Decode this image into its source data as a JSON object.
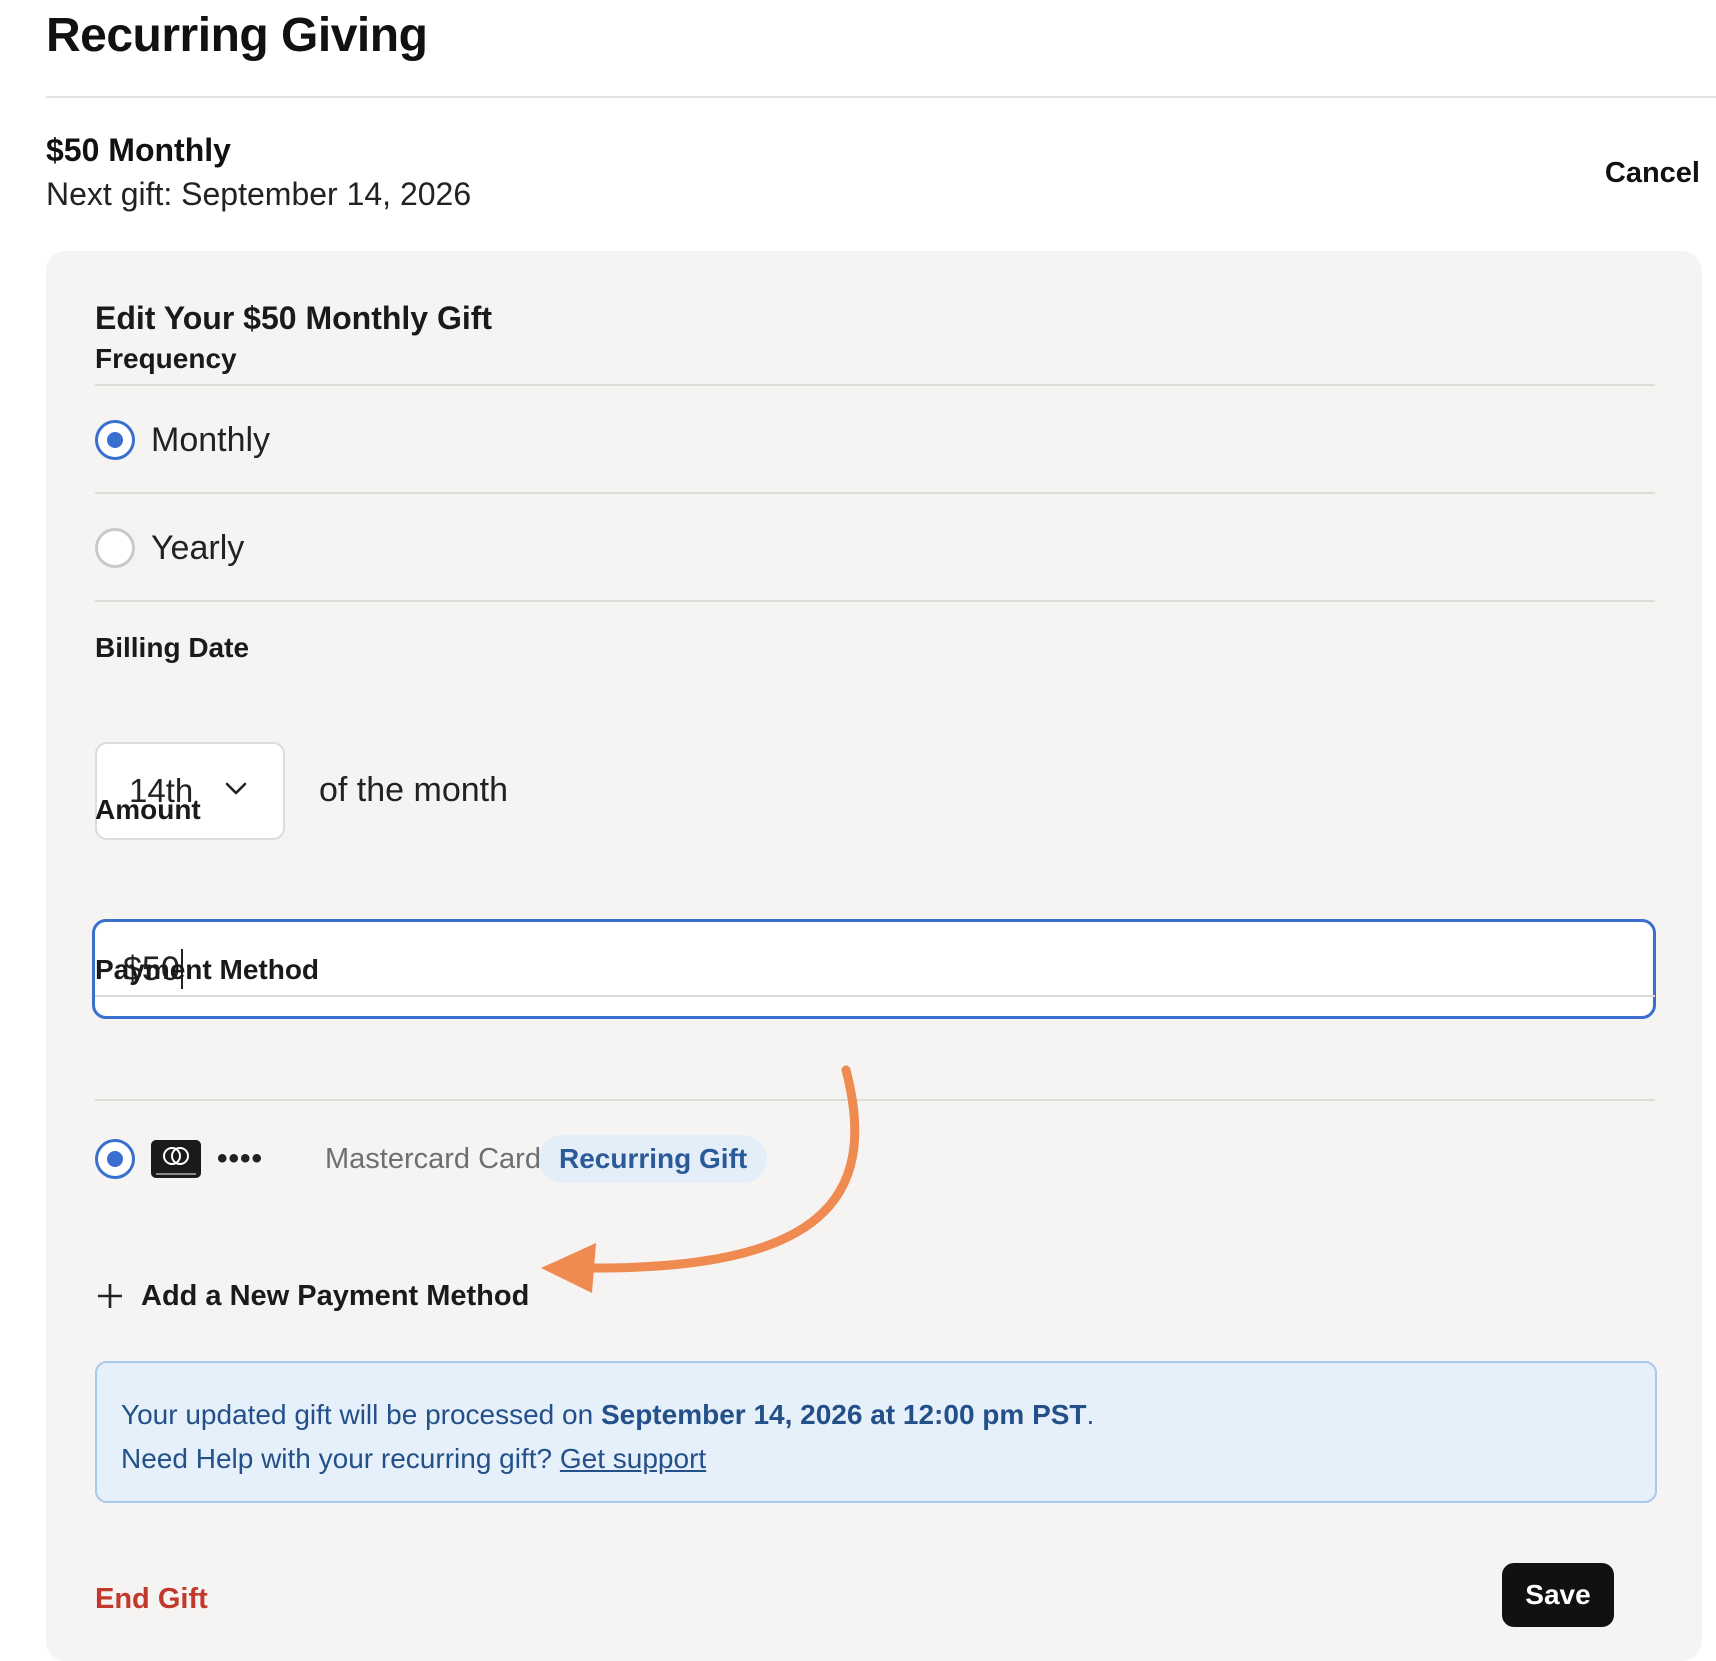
{
  "page": {
    "title": "Recurring Giving"
  },
  "summary": {
    "amount_label": "$50 Monthly",
    "next_gift": "Next gift: September 14, 2026",
    "cancel_label": "Cancel"
  },
  "edit": {
    "title": "Edit Your $50 Monthly Gift",
    "frequency": {
      "label": "Frequency",
      "options": [
        {
          "label": "Monthly",
          "selected": true
        },
        {
          "label": "Yearly",
          "selected": false
        }
      ]
    },
    "billing_date": {
      "label": "Billing Date",
      "selected": "14th",
      "suffix": "of the month"
    },
    "amount": {
      "label": "Amount",
      "value": "$50"
    },
    "payment_method": {
      "label": "Payment Method",
      "cards": [
        {
          "masked_number": "••••",
          "name": "Mastercard Card",
          "badge": "Recurring Gift",
          "selected": true,
          "icon": "mastercard-icon"
        }
      ],
      "add_label": "Add a New Payment Method"
    },
    "info": {
      "line1_prefix": "Your updated gift will be processed on ",
      "line1_bold": "September 14, 2026 at 12:00 pm PST",
      "line1_suffix": ".",
      "line2_prefix": "Need Help with your recurring gift? ",
      "line2_link": "Get support"
    },
    "end_gift_label": "End Gift",
    "save_label": "Save"
  },
  "colors": {
    "accent": "#3a6fd0",
    "annotation": "#ef8a50",
    "danger": "#c0392b",
    "info_bg": "#e6f0fa"
  }
}
